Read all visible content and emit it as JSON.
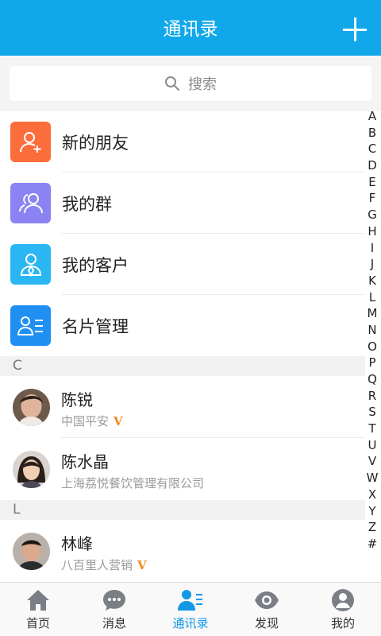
{
  "header": {
    "title": "通讯录",
    "add_icon": "plus-icon"
  },
  "search": {
    "placeholder": "搜索",
    "icon": "search-icon"
  },
  "menu": [
    {
      "label": "新的朋友",
      "icon": "add-friend-icon",
      "color": "#fb6e3c"
    },
    {
      "label": "我的群",
      "icon": "group-icon",
      "color": "#8b83f3"
    },
    {
      "label": "我的客户",
      "icon": "customer-icon",
      "color": "#2ab6f3"
    },
    {
      "label": "名片管理",
      "icon": "card-manage-icon",
      "color": "#1f8ff2"
    }
  ],
  "sections": [
    {
      "letter": "C",
      "contacts": [
        {
          "name": "陈锐",
          "company": "中国平安",
          "verified": "V"
        },
        {
          "name": "陈水晶",
          "company": "上海荔悦餐饮管理有限公司",
          "verified": ""
        }
      ]
    },
    {
      "letter": "L",
      "contacts": [
        {
          "name": "林峰",
          "company": "八百里人营销",
          "verified": "V"
        }
      ]
    }
  ],
  "index_letters": [
    "A",
    "B",
    "C",
    "D",
    "E",
    "F",
    "G",
    "H",
    "I",
    "J",
    "K",
    "L",
    "M",
    "N",
    "O",
    "P",
    "Q",
    "R",
    "S",
    "T",
    "U",
    "V",
    "W",
    "X",
    "Y",
    "Z",
    "#"
  ],
  "tabs": [
    {
      "label": "首页",
      "icon": "home-icon"
    },
    {
      "label": "消息",
      "icon": "message-icon"
    },
    {
      "label": "通讯录",
      "icon": "contacts-icon",
      "active": true
    },
    {
      "label": "发现",
      "icon": "eye-icon"
    },
    {
      "label": "我的",
      "icon": "profile-icon"
    }
  ],
  "colors": {
    "accent": "#10a8ea",
    "active_tab": "#1398e6",
    "verified": "#f08a1c"
  }
}
